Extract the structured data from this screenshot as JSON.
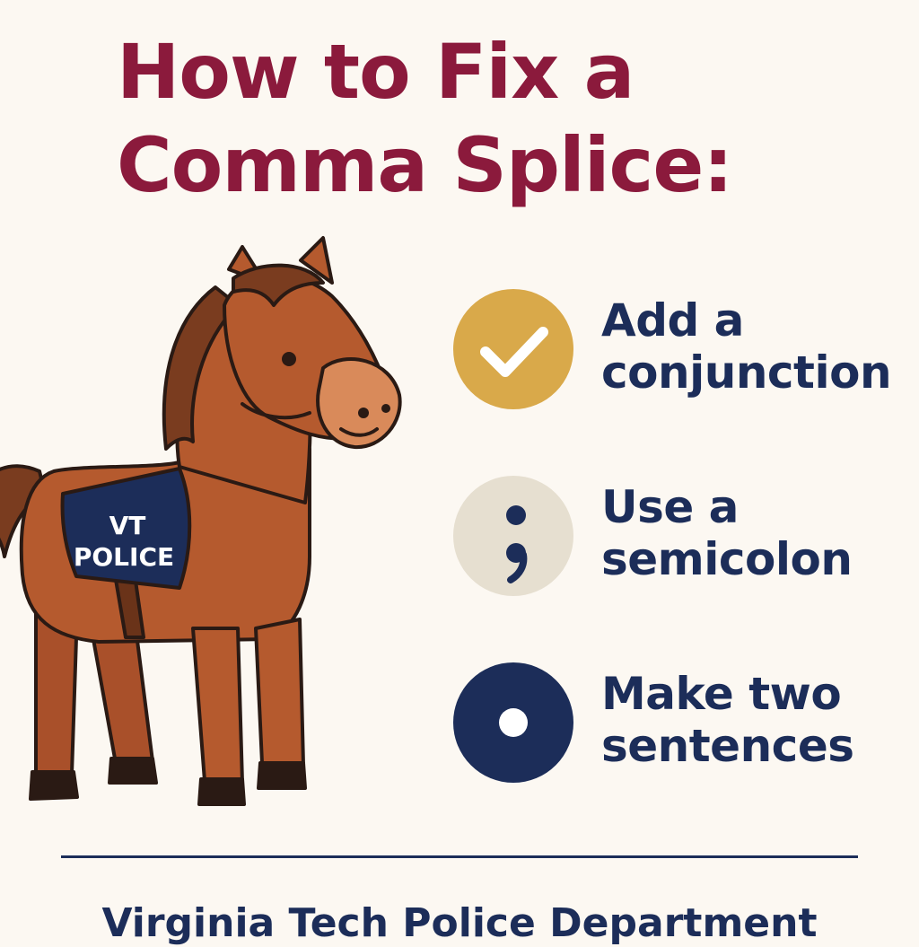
{
  "title": {
    "line1": "How to Fix a",
    "line2": "Comma Splice:"
  },
  "mascot": {
    "blanket_line1": "VT",
    "blanket_line2": "POLICE"
  },
  "tips": [
    {
      "icon": "checkmark-icon",
      "color": "#d9a94a",
      "line1": "Add a",
      "line2": "conjunction"
    },
    {
      "icon": "semicolon-icon",
      "color": "#e6dfd0",
      "line1": "Use a",
      "line2": "semicolon"
    },
    {
      "icon": "period-icon",
      "color": "#1c2d59",
      "line1": "Make two",
      "line2": "sentences"
    }
  ],
  "footer": {
    "text": "Virginia Tech Police Department"
  },
  "colors": {
    "title": "#8b1a3c",
    "text": "#1c2d59",
    "background": "#fcf8f2",
    "horse_body": "#b55a2e",
    "horse_mane": "#7a3c1f",
    "blanket": "#1c2d59"
  }
}
